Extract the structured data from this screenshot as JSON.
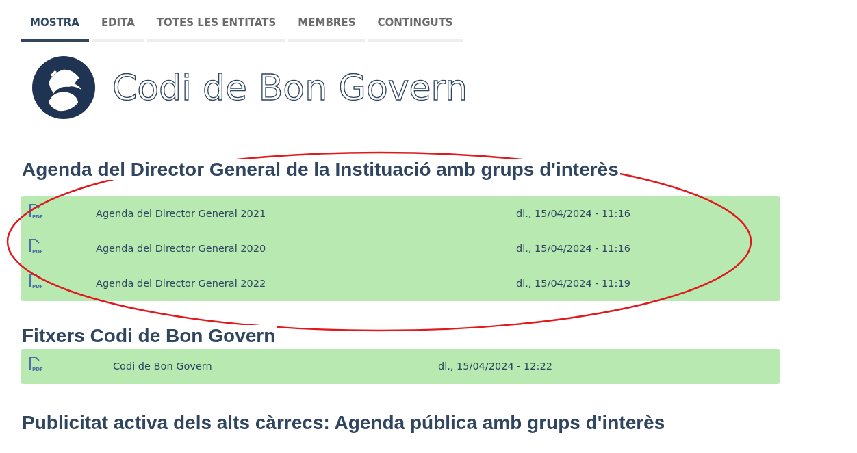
{
  "tabs": [
    {
      "label": "MOSTRA",
      "selected": true
    },
    {
      "label": "EDITA",
      "selected": false
    },
    {
      "label": "TOTES LES ENTITATS",
      "selected": false
    },
    {
      "label": "MEMBRES",
      "selected": false
    },
    {
      "label": "CONTINGUTS",
      "selected": false
    }
  ],
  "page_title": "Codi de Bon Govern",
  "sections": [
    {
      "heading": "Agenda del Director General de la Instituació amb grups d'interès",
      "files": [
        {
          "type": "PDF",
          "name": "Agenda del Director General 2021",
          "date": "dl., 15/04/2024 - 11:16"
        },
        {
          "type": "PDF",
          "name": "Agenda del Director General 2020",
          "date": "dl., 15/04/2024 - 11:16"
        },
        {
          "type": "PDF",
          "name": "Agenda del Director General 2022",
          "date": "dl., 15/04/2024 - 11:19"
        }
      ]
    },
    {
      "heading": "Fitxers Codi de Bon Govern",
      "files": [
        {
          "type": "PDF",
          "name": "Codi de Bon Govern",
          "date": "dl., 15/04/2024 - 12:22"
        }
      ]
    },
    {
      "heading": "Publicitat activa dels alts càrrecs: Agenda pública amb grups d'interès"
    }
  ]
}
